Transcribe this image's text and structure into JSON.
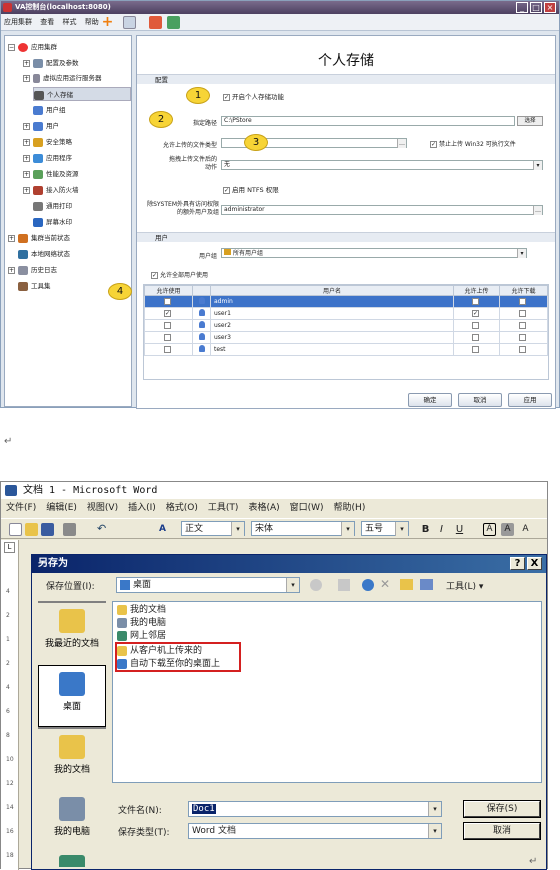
{
  "app1": {
    "title": "VA控制台(localhost:8080)",
    "menu": [
      "应用集群",
      "查看",
      "样式",
      "帮助"
    ],
    "tree": [
      {
        "label": "应用集群",
        "level": 0,
        "exp": "−"
      },
      {
        "label": "配置及参数",
        "level": 1,
        "exp": "+"
      },
      {
        "label": "虚拟应用运行服务器",
        "level": 1,
        "exp": "+"
      },
      {
        "label": "个人存储",
        "level": 1,
        "exp": ""
      },
      {
        "label": "用户组",
        "level": 1,
        "exp": ""
      },
      {
        "label": "用户",
        "level": 1,
        "exp": "+"
      },
      {
        "label": "安全策略",
        "level": 1,
        "exp": "+"
      },
      {
        "label": "应用程序",
        "level": 1,
        "exp": "+"
      },
      {
        "label": "性能及资源",
        "level": 1,
        "exp": "+"
      },
      {
        "label": "接入防火墙",
        "level": 1,
        "exp": "+"
      },
      {
        "label": "通用打印",
        "level": 1,
        "exp": ""
      },
      {
        "label": "屏幕水印",
        "level": 1,
        "exp": ""
      },
      {
        "label": "集群当前状态",
        "level": 0,
        "exp": "+"
      },
      {
        "label": "本地网络状态",
        "level": 0,
        "exp": ""
      },
      {
        "label": "历史日志",
        "level": 0,
        "exp": "+"
      },
      {
        "label": "工具集",
        "level": 0,
        "exp": ""
      }
    ],
    "panel_title": "个人存储",
    "config_group": "配置",
    "enable_label": "开启个人存储功能",
    "path_label": "指定路径",
    "path_value": "C:\\PStore",
    "browse_label": "选择",
    "filetype_label": "允许上传的文件类型",
    "block_win32_label": "禁止上传 Win32 可执行文件",
    "drag_label": "拖拽上传文件后的动作",
    "drag_value": "无",
    "ntfs_label": "启用 NTFS 权限",
    "extra_user_label": "除SYSTEM外具有访问权限的额外用户及组",
    "extra_user_value": "administrator",
    "user_group_section": "用户",
    "usergroup_label": "用户组",
    "usergroup_value": "所有用户组",
    "allow_all_label": "允许全部用户使用",
    "table_headers": [
      "允许使用",
      "用户名",
      "允许上传",
      "允许下载"
    ],
    "table_rows": [
      {
        "allow": "✓",
        "name": "admin",
        "up": "✓",
        "down": "✓"
      },
      {
        "allow": "✓",
        "name": "user1",
        "up": "✓",
        "down": ""
      },
      {
        "allow": "",
        "name": "user2",
        "up": "",
        "down": ""
      },
      {
        "allow": "",
        "name": "user3",
        "up": "",
        "down": ""
      },
      {
        "allow": "",
        "name": "test",
        "up": "",
        "down": ""
      }
    ],
    "callouts": [
      "1",
      "2",
      "3",
      "4"
    ],
    "buttons": {
      "ok": "确定",
      "cancel": "取消",
      "apply": "应用"
    }
  },
  "para_mark": "↵",
  "word": {
    "title": "文档 1 - Microsoft Word",
    "menu": [
      "文件(F)",
      "编辑(E)",
      "视图(V)",
      "插入(I)",
      "格式(O)",
      "工具(T)",
      "表格(A)",
      "窗口(W)",
      "帮助(H)"
    ],
    "style_value": "正文",
    "font_value": "宋体",
    "size_value": "五号",
    "ruler_marks": [
      "L",
      "4",
      "2",
      "1",
      "2",
      "4",
      "6",
      "8",
      "10",
      "12",
      "14",
      "16",
      "18"
    ]
  },
  "dialog": {
    "title": "另存为",
    "help": "?",
    "close": "X",
    "location_label": "保存位置(I):",
    "location_value": "桌面",
    "tools_label": "工具(L)",
    "places": [
      "我最近的文档",
      "桌面",
      "我的文档",
      "我的电脑",
      ""
    ],
    "files": [
      "我的文档",
      "我的电脑",
      "网上邻居",
      "从客户机上传来的",
      "自动下载至你的桌面上"
    ],
    "filename_label": "文件名(N):",
    "filename_value": "Doc1",
    "filetype_label": "保存类型(T):",
    "filetype_value": "Word 文档",
    "save_label": "保存(S)",
    "cancel_label": "取消"
  },
  "colors": {
    "accent": "#3d73c9",
    "callout": "#f7d436",
    "highlight_border": "#d42020"
  }
}
